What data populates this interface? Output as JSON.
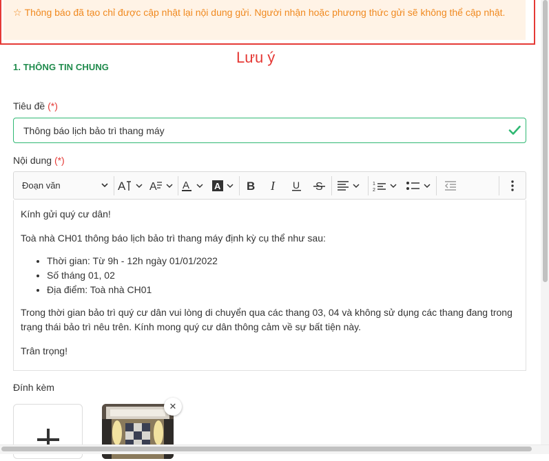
{
  "notice": {
    "text": "Thông báo đã tạo chỉ được cập nhật lại nội dung gửi. Người nhận hoặc phương thức gửi sẽ không thể cập nhật.",
    "icon": "star-outline-icon",
    "color": "#f0891f",
    "background": "#fff3e6"
  },
  "annotation": {
    "label": "Lưu ý",
    "color": "#e53935"
  },
  "section": {
    "title": "1. THÔNG TIN CHUNG",
    "color": "#1f8b4c"
  },
  "form": {
    "title_label": "Tiêu đề",
    "required_mark": "(*)",
    "title_value": "Thông báo lịch bảo trì thang máy",
    "content_label": "Nội dung",
    "attach_label": "Đính kèm"
  },
  "toolbar": {
    "heading_value": "Đoạn văn",
    "icons": [
      "font-size-icon",
      "font-family-icon",
      "font-color-icon",
      "highlight-icon",
      "bold-icon",
      "italic-icon",
      "underline-icon",
      "strikethrough-icon",
      "align-icon",
      "numbered-list-icon",
      "bulleted-list-icon",
      "outdent-icon",
      "more-icon"
    ]
  },
  "editor": {
    "greeting": "Kính gửi quý cư dân!",
    "intro": "Toà nhà CH01 thông báo lịch bảo trì thang máy định kỳ cụ thể như sau:",
    "bullets": [
      "Thời gian: Từ 9h - 12h ngày 01/01/2022",
      "Số tháng 01, 02",
      "Địa điểm: Toà nhà CH01"
    ],
    "body": "Trong thời gian bảo trì quý cư dân vui lòng di chuyển qua các thang 03, 04 và không sử dụng các thang đang trong trạng thái bảo trì nêu trên. Kính mong quý cư dân thông cảm về sự bất tiện này.",
    "closing": "Trân trọng!"
  },
  "attachments": {
    "add_icon": "plus-icon",
    "remove_icon": "close-icon"
  }
}
